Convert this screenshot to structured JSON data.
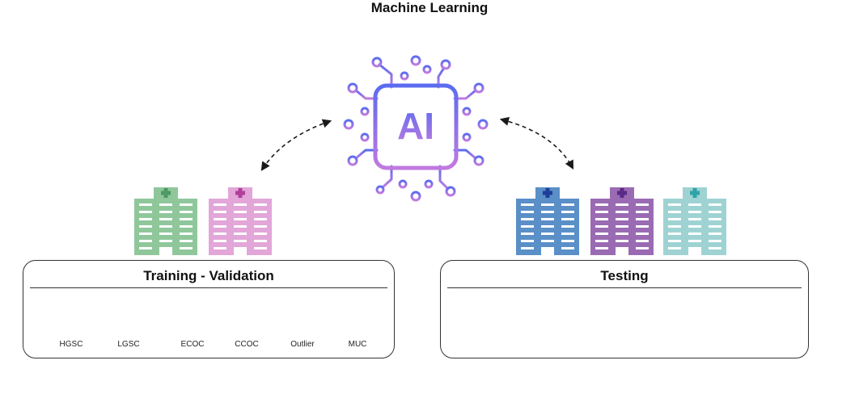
{
  "header": {
    "title": "Machine Learning"
  },
  "chip": {
    "label": "AI"
  },
  "colors": {
    "ai_gradient_top": "#5b6cf0",
    "ai_gradient_bottom": "#c07ae0",
    "arrow": "#1a1a1a"
  },
  "training": {
    "title": "Training - Validation",
    "hospitals": [
      {
        "icon": "hospital-building-icon",
        "color": "#8fc79b",
        "cross": "#4d9a63"
      },
      {
        "icon": "hospital-building-icon",
        "color": "#e2a6d9",
        "cross": "#b0409a"
      }
    ],
    "slides": [
      {
        "label": "HGSC",
        "fill": "#c6bfdc",
        "edge": "#9a8fc4"
      },
      {
        "label": "LGSC",
        "fill": "#8e6db6",
        "edge": "#5b3f8c"
      },
      {
        "label": "ECOC",
        "fill": "#9c3f73",
        "edge": "#6e2050"
      },
      {
        "label": "CCOC",
        "fill": "#b46f8f",
        "edge": "#7e3f5f"
      },
      {
        "label": "Outlier",
        "fill": "#c9b1dc",
        "edge": "#a57fc7"
      },
      {
        "label": "MUC",
        "fill": "#bdb0dc",
        "edge": "#8a7bbd"
      }
    ]
  },
  "testing": {
    "title": "Testing",
    "hospitals": [
      {
        "icon": "hospital-building-icon",
        "color": "#5a8fc8",
        "cross": "#1e3f9a"
      },
      {
        "icon": "hospital-building-icon",
        "color": "#9a6bb3",
        "cross": "#5a2a86"
      },
      {
        "icon": "hospital-building-icon",
        "color": "#9fd3d3",
        "cross": "#2fa3a8"
      }
    ],
    "slides": [
      {
        "fill": "#d98bc1",
        "edge": "#a9509a"
      },
      {
        "fill": "#a8409a",
        "edge": "#7a2070"
      },
      {
        "fill": "#e67ca6",
        "edge": "#c04a7e"
      },
      {
        "fill": "#b98aa6",
        "edge": "#6e4a60"
      },
      {
        "fill": "#f1c8e3",
        "edge": "#d592c3"
      },
      {
        "fill": "#e79bc8",
        "edge": "#c465a4"
      }
    ]
  }
}
